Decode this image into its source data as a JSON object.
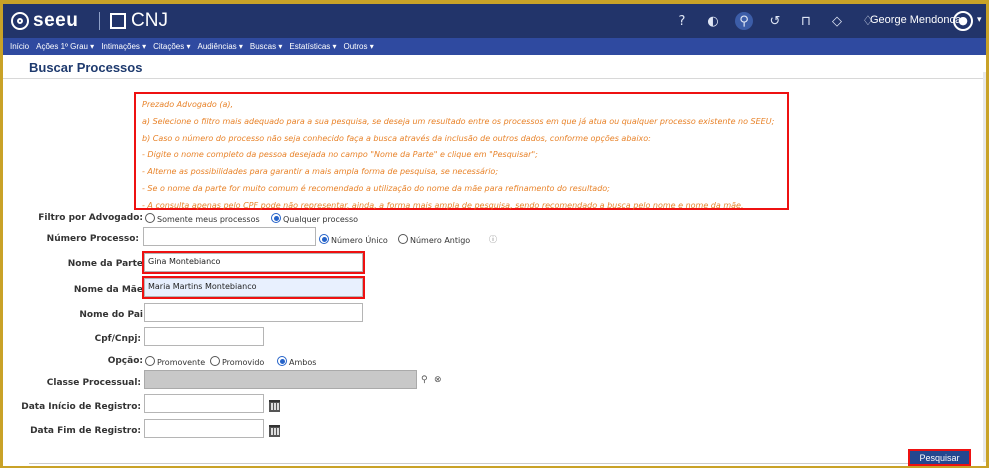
{
  "header": {
    "logo_text": "seeu",
    "cnj_text": "CNJ",
    "user_name": "George Mendonca",
    "icons": [
      "help-icon",
      "contrast-icon",
      "search-icon",
      "history-icon",
      "bookmark-icon",
      "tag-icon",
      "bell-icon"
    ]
  },
  "nav": [
    "Início",
    "Ações 1º Grau ▾",
    "Intimações ▾",
    "Citações ▾",
    "Audiências ▾",
    "Buscas ▾",
    "Estatísticas ▾",
    "Outros ▾"
  ],
  "page_title": "Buscar Processos",
  "notice": [
    "Prezado Advogado (a),",
    "a) Selecione o filtro mais adequado para a sua pesquisa, se deseja um resultado entre os processos em que já atua ou qualquer processo existente no SEEU;",
    "b) Caso o número do processo não seja conhecido faça a busca através da inclusão de outros dados, conforme opções abaixo:",
    "- Digite o nome completo da pessoa desejada no campo \"Nome da Parte\" e clique em \"Pesquisar\";",
    "- Alterne as possibilidades para garantir a mais ampla forma de pesquisa, se necessário;",
    "- Se o nome da parte for muito comum é recomendado a utilização do nome da mãe para refinamento do resultado;",
    "- A consulta apenas pelo CPF pode não representar, ainda, a forma mais ampla de pesquisa, sendo recomendado a busca pelo nome e nome da mãe."
  ],
  "form": {
    "filtro_label": "Filtro por Advogado:",
    "filtro_opt1": "Somente meus processos",
    "filtro_opt2": "Qualquer processo",
    "numero_label": "Número Processo:",
    "numero_value": "",
    "numero_opt1": "Número Único",
    "numero_opt2": "Número Antigo",
    "parte_label": "Nome da Parte",
    "parte_value": "Gina Montebianco",
    "mae_label": "Nome da Mãe",
    "mae_value": "Maria Martins Montebianco",
    "pai_label": "Nome do Pai",
    "pai_value": "",
    "cpf_label": "Cpf/Cnpj:",
    "cpf_value": "",
    "opcao_label": "Opção:",
    "opcao_opt1": "Promovente",
    "opcao_opt2": "Promovido",
    "opcao_opt3": "Ambos",
    "classe_label": "Classe Processual:",
    "classe_value": "",
    "data_inicio_label": "Data Início de Registro:",
    "data_inicio_value": "",
    "data_fim_label": "Data Fim de Registro:",
    "data_fim_value": ""
  },
  "submit_label": "Pesquisar"
}
